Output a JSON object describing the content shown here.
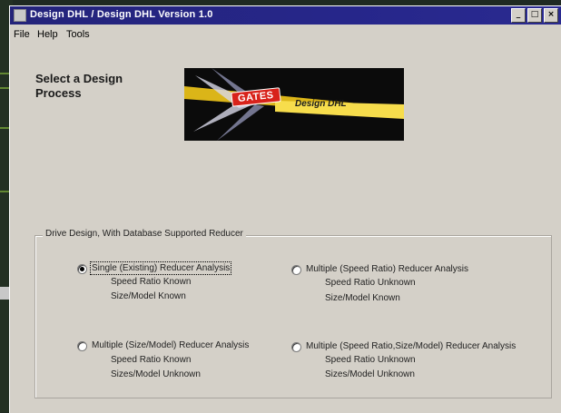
{
  "window": {
    "title": "Design DHL / Design DHL Version 1.0",
    "buttons": [
      "_",
      "□",
      "×"
    ]
  },
  "menu": [
    "File",
    "Help",
    "Tools"
  ],
  "heading": "Select a Design Process",
  "logo": {
    "brand": "GATES",
    "product": "Design DHL"
  },
  "group": {
    "legend": "Drive Design, With Database Supported Reducer",
    "options": [
      {
        "label": "Single (Existing) Reducer Analysis",
        "line1": "Speed Ratio Known",
        "line2": "Size/Model Known",
        "selected": true
      },
      {
        "label": "Multiple (Speed Ratio) Reducer Analysis",
        "line1": "Speed Ratio Unknown",
        "line2": "Size/Model Known",
        "selected": false
      },
      {
        "label": "Multiple (Size/Model) Reducer Analysis",
        "line1": "Speed Ratio Known",
        "line2": "Sizes/Model Unknown",
        "selected": false
      },
      {
        "label": "Multiple (Speed Ratio,Size/Model) Reducer Analysis",
        "line1": "Speed Ratio Unknown",
        "line2": "Sizes/Model Unknown",
        "selected": false
      }
    ]
  },
  "colors": {
    "titlebar": "#24247a",
    "window": "#d4d0c8",
    "logo_bg": "#0b0b0b",
    "brand_red": "#d8231b",
    "streak": "#f2c81a"
  }
}
